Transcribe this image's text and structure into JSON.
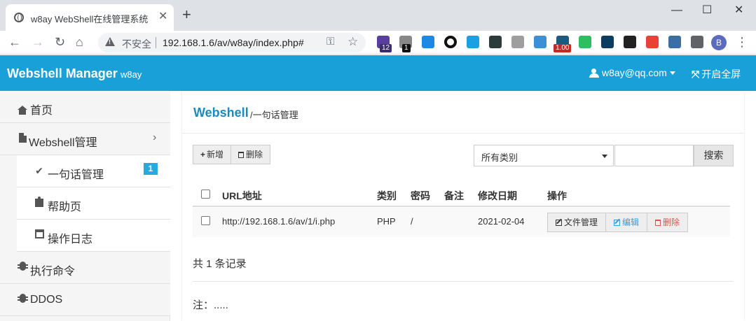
{
  "browser": {
    "tab_title": "w8ay WebShell在线管理系统",
    "tab_close": "✕",
    "new_tab": "+",
    "win_minimize": "—",
    "win_maximize": "☐",
    "win_close": "✕",
    "nav_back": "←",
    "nav_forward": "→",
    "nav_reload": "↻",
    "nav_home": "⌂",
    "insecure_label": "不安全",
    "url": "192.168.1.6/av/w8ay/index.php#",
    "key_icon": "⚿",
    "star_icon": "☆",
    "extensions": [
      {
        "name": "ext-purple-icon",
        "color": "#5a3e9e",
        "badge": "12"
      },
      {
        "name": "ext-link-icon",
        "color": "#888888",
        "badge": "1"
      },
      {
        "name": "ext-pin-icon",
        "color": "#1e88e5",
        "badge": ""
      },
      {
        "name": "ext-ring-icon",
        "color": "#111111",
        "badge": ""
      },
      {
        "name": "ext-cube-icon",
        "color": "#1ba1e2",
        "badge": ""
      },
      {
        "name": "ext-dark-icon",
        "color": "#2d3b3b",
        "badge": ""
      },
      {
        "name": "ext-mail-icon",
        "color": "#9e9e9e",
        "badge": ""
      },
      {
        "name": "ext-arrow-icon",
        "color": "#3d8fd6",
        "badge": ""
      },
      {
        "name": "ext-flag-icon",
        "color": "#1c5a86",
        "badge": "1.00"
      },
      {
        "name": "ext-evernote-icon",
        "color": "#2dbe60",
        "badge": ""
      },
      {
        "name": "ext-chart-icon",
        "color": "#0d3c61",
        "badge": ""
      },
      {
        "name": "ext-tape-icon",
        "color": "#222222",
        "badge": ""
      },
      {
        "name": "ext-google-icon",
        "color": "#e94235",
        "badge": ""
      },
      {
        "name": "ext-grid-icon",
        "color": "#3a6ea5",
        "badge": ""
      },
      {
        "name": "ext-puzzle-icon",
        "color": "#5f6368",
        "badge": ""
      }
    ],
    "avatar_letter": "B",
    "more_icon": "⋮"
  },
  "header": {
    "brand": "Webshell Manager",
    "brand_sub": "w8ay",
    "user": "w8ay@qq.com",
    "fullscreen_icon": "⤧",
    "fullscreen_label": "开启全屏",
    "color": "#1aa0d8"
  },
  "sidebar": {
    "items": [
      {
        "label": "首页",
        "icon": "home-icon"
      },
      {
        "label": "Webshell管理",
        "icon": "file-icon",
        "chevron": "›"
      },
      {
        "label": "一句话管理",
        "icon": "check-icon",
        "check": "✔",
        "badge": "1"
      },
      {
        "label": "帮助页",
        "icon": "puzzle-icon"
      },
      {
        "label": "操作日志",
        "icon": "calendar-icon"
      },
      {
        "label": "执行命令",
        "icon": "bug-icon"
      },
      {
        "label": "DDOS",
        "icon": "bug-icon"
      }
    ]
  },
  "main": {
    "title": "Webshell",
    "subtitle": "/一句话管理",
    "add_label": "新增",
    "add_plus": "+",
    "delete_label": "删除",
    "category_select": "所有类别",
    "search_value": "",
    "search_button": "搜索",
    "table": {
      "columns": [
        "URL地址",
        "类别",
        "密码",
        "备注",
        "修改日期",
        "操作"
      ],
      "rows": [
        {
          "url": "http://192.168.1.6/av/1/i.php",
          "type": "PHP",
          "password": "/",
          "remark": "",
          "date": "2021-02-04",
          "actions": [
            "文件管理",
            "编辑",
            "删除"
          ]
        }
      ]
    },
    "records": "共 1 条记录",
    "note": "注：....."
  }
}
